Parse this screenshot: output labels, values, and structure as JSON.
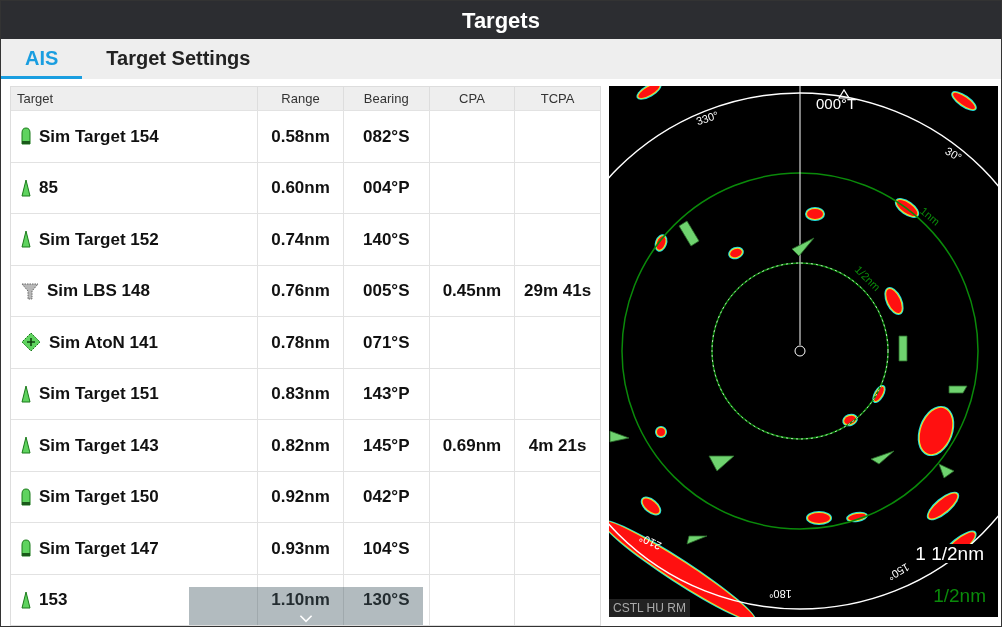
{
  "title": "Targets",
  "tabs": [
    {
      "label": "AIS",
      "selected": true
    },
    {
      "label": "Target Settings",
      "selected": false
    }
  ],
  "table": {
    "columns": [
      "Target",
      "Range",
      "Bearing",
      "CPA",
      "TCPA"
    ],
    "rows": [
      {
        "kind": "vessel",
        "target": "Sim Target 154",
        "range": "0.58nm",
        "bearing": "082°S"
      },
      {
        "kind": "triangle",
        "target": "85",
        "range": "0.60nm",
        "bearing": "004°P"
      },
      {
        "kind": "triangle",
        "target": "Sim Target 152",
        "range": "0.74nm",
        "bearing": "140°S"
      },
      {
        "kind": "lbs",
        "target": "Sim LBS 148",
        "range": "0.76nm",
        "bearing": "005°S",
        "cpa": "0.45nm",
        "tcpa": "29m 41s"
      },
      {
        "kind": "aton",
        "target": "Sim AtoN 141",
        "range": "0.78nm",
        "bearing": "071°S"
      },
      {
        "kind": "triangle",
        "target": "Sim Target 151",
        "range": "0.83nm",
        "bearing": "143°P"
      },
      {
        "kind": "triangle",
        "target": "Sim Target 143",
        "range": "0.82nm",
        "bearing": "145°P",
        "cpa": "0.69nm",
        "tcpa": "4m 21s"
      },
      {
        "kind": "vessel",
        "target": "Sim Target 150",
        "range": "0.92nm",
        "bearing": "042°P"
      },
      {
        "kind": "vessel",
        "target": "Sim Target 147",
        "range": "0.93nm",
        "bearing": "104°S"
      },
      {
        "kind": "triangle",
        "target": "153",
        "range": "1.10nm",
        "bearing": "130°S"
      }
    ]
  },
  "radar": {
    "heading": "000°T",
    "bearing_labels": [
      "330°",
      "30°",
      "210°",
      "180°",
      "150°"
    ],
    "ring_labels": [
      "1nm",
      "1/2nm"
    ],
    "range": "1 1/2nm",
    "ring_interval": "1/2nm",
    "mode": "CSTL HU RM"
  }
}
